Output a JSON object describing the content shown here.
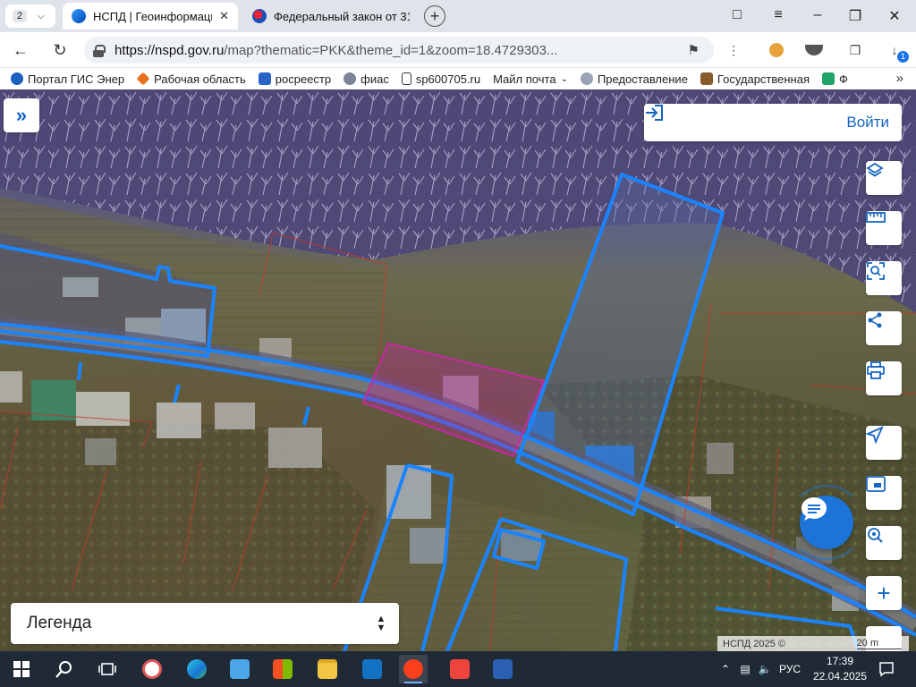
{
  "browser": {
    "tab_count": "2",
    "tabs": [
      {
        "title": "НСПД | Геоинформаци",
        "active": true
      },
      {
        "title": "Федеральный закон от 31",
        "active": false
      }
    ],
    "url": {
      "host": "https://nspd.gov.ru",
      "path": "/map?thematic=PKK&theme_id=1&zoom=18.4729303..."
    },
    "downloads_badge": "1",
    "bookmarks": [
      {
        "label": "Портал ГИС Энер",
        "icon": "globe-icon"
      },
      {
        "label": "Рабочая область",
        "icon": "esri-icon"
      },
      {
        "label": "росреестр",
        "icon": "rosreestr-icon"
      },
      {
        "label": "фиас",
        "icon": "fias-icon"
      },
      {
        "label": "sp600705.ru",
        "icon": "document-icon"
      },
      {
        "label": "Майл почта",
        "icon": "chevron-down-icon"
      },
      {
        "label": "Предоставление",
        "icon": "gov-icon"
      },
      {
        "label": "Государственная",
        "icon": "building-icon"
      },
      {
        "label": "Ф",
        "icon": "green-icon"
      }
    ]
  },
  "map": {
    "login_label": "Войти",
    "legend_label": "Легенда",
    "attribution": "НСПД 2025 ©",
    "scale_label": "20 m",
    "controls": [
      "expand-panel",
      "layers",
      "ruler",
      "select-area",
      "share",
      "print",
      "geolocation",
      "fit-screen",
      "search-location",
      "zoom-in"
    ],
    "colors": {
      "parcel_outline": "#1a84ff",
      "selected_parcel": "#c0249a",
      "cadastral_line": "#c0392b",
      "chat_button": "#1d74d8"
    }
  },
  "taskbar": {
    "language": "РУС",
    "time": "17:39",
    "date": "22.04.2025",
    "apps": [
      "start",
      "search",
      "task-view",
      "chromium",
      "edge",
      "control-panel",
      "store",
      "file-explorer",
      "outlook",
      "yandex-browser",
      "anydesk",
      "word"
    ]
  }
}
